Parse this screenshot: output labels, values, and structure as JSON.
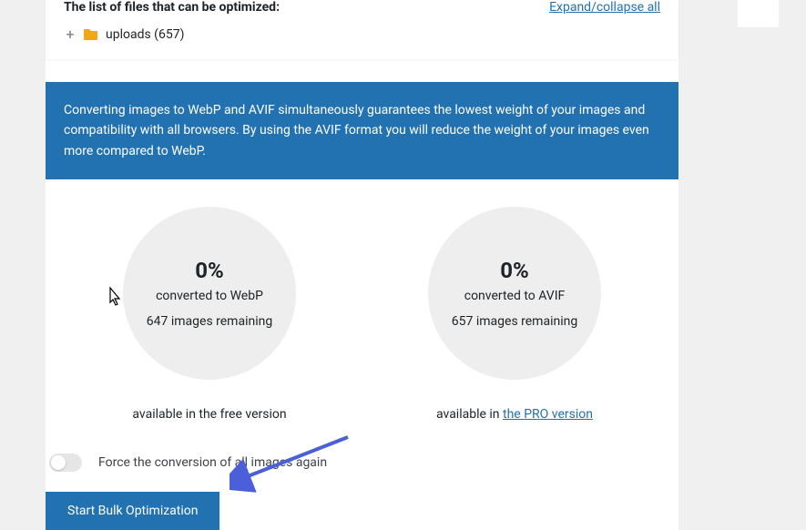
{
  "folder_section": {
    "title": "The list of files that can be optimized:",
    "expand_label": "Expand/collapse all",
    "plus": "+",
    "uploads_label": "uploads (657)"
  },
  "info_text": "Converting images to WebP and AVIF simultaneously guarantees the lowest weight of your images and compatibility with all browsers. By using the AVIF format you will reduce the weight of your images even more compared to WebP.",
  "webp": {
    "percent": "0%",
    "subtitle": "converted to WebP",
    "remaining": "647 images remaining",
    "avail": "available in the free version"
  },
  "avif": {
    "percent": "0%",
    "subtitle": "converted to AVIF",
    "remaining": "657 images remaining",
    "avail_prefix": "available in ",
    "avail_link": "the PRO version"
  },
  "force_label": "Force the conversion of all images again",
  "start_button": "Start Bulk Optimization"
}
